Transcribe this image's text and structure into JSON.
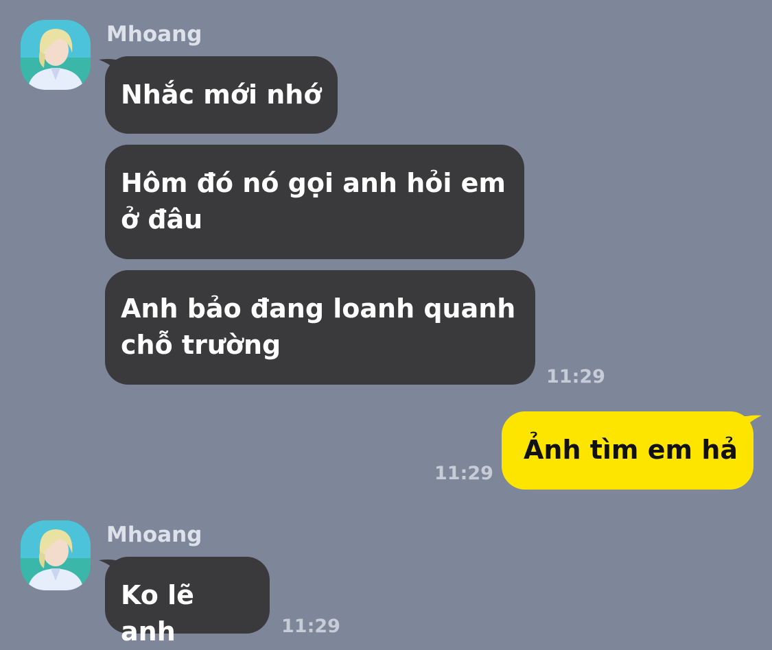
{
  "colors": {
    "background": "#7e8699",
    "incoming_bubble": "#3a3a3c",
    "outgoing_bubble": "#fee500",
    "incoming_text": "#ffffff",
    "outgoing_text": "#111111",
    "meta_text": "#c7ccd7"
  },
  "groups": [
    {
      "sender": "Mhoang",
      "messages": [
        {
          "text": "Nhắc mới nhớ"
        },
        {
          "text": "Hôm đó nó gọi anh hỏi em ở đâu"
        },
        {
          "text": "Anh bảo đang loanh quanh chỗ trường"
        }
      ],
      "time": "11:29"
    },
    {
      "sender": "me",
      "messages": [
        {
          "text": "Ảnh tìm em hả"
        }
      ],
      "time": "11:29"
    },
    {
      "sender": "Mhoang",
      "messages": [
        {
          "text": "Ko lẽ anh"
        }
      ],
      "time": "11:29"
    }
  ]
}
